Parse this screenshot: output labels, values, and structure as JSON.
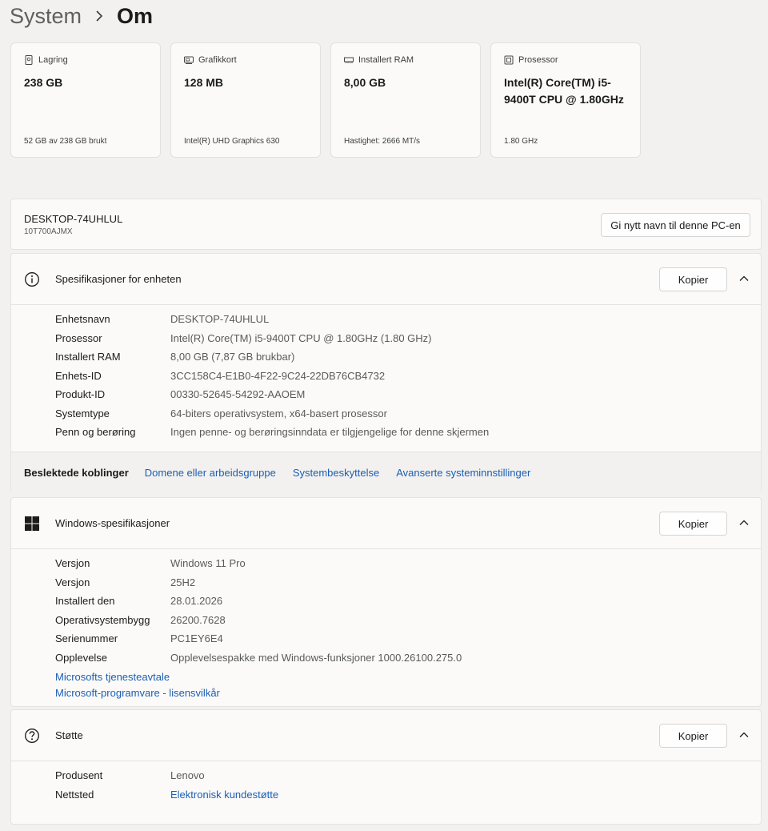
{
  "breadcrumb": {
    "parent": "System",
    "current": "Om"
  },
  "cards": [
    {
      "icon": "storage-icon",
      "label": "Lagring",
      "value": "238 GB",
      "sub": "52 GB av 238 GB brukt"
    },
    {
      "icon": "graphics-card-icon",
      "label": "Grafikkort",
      "value": "128 MB",
      "sub": "Intel(R) UHD Graphics 630"
    },
    {
      "icon": "ram-icon",
      "label": "Installert RAM",
      "value": "8,00 GB",
      "sub": "Hastighet: 2666 MT/s"
    },
    {
      "icon": "processor-icon",
      "label": "Prosessor",
      "value": "Intel(R) Core(TM) i5-9400T CPU @ 1.80GHz",
      "sub": "1.80 GHz"
    }
  ],
  "device": {
    "name": "DESKTOP-74UHLUL",
    "model": "10T700AJMX",
    "rename_label": "Gi nytt navn til denne PC-en"
  },
  "device_specs": {
    "title": "Spesifikasjoner for enheten",
    "copy_label": "Kopier",
    "rows": [
      {
        "key": "Enhetsnavn",
        "value": "DESKTOP-74UHLUL"
      },
      {
        "key": "Prosessor",
        "value": "Intel(R) Core(TM) i5-9400T CPU @ 1.80GHz (1.80 GHz)"
      },
      {
        "key": "Installert RAM",
        "value": "8,00 GB (7,87 GB brukbar)"
      },
      {
        "key": "Enhets-ID",
        "value": "3CC158C4-E1B0-4F22-9C24-22DB76CB4732"
      },
      {
        "key": "Produkt-ID",
        "value": "00330-52645-54292-AAOEM"
      },
      {
        "key": "Systemtype",
        "value": "64-biters operativsystem, x64-basert prosessor"
      },
      {
        "key": "Penn og berøring",
        "value": "Ingen penne- og berøringsinndata er tilgjengelige for denne skjermen"
      }
    ],
    "related_label": "Beslektede koblinger",
    "related_links": [
      "Domene eller arbeidsgruppe",
      "Systembeskyttelse",
      "Avanserte systeminnstillinger"
    ]
  },
  "windows_specs": {
    "title": "Windows-spesifikasjoner",
    "copy_label": "Kopier",
    "rows": [
      {
        "key": "Versjon",
        "value": "Windows 11 Pro"
      },
      {
        "key": "Versjon",
        "value": "25H2"
      },
      {
        "key": "Installert den",
        "value": "28.01.2026"
      },
      {
        "key": "Operativsystembygg",
        "value": "26200.7628"
      },
      {
        "key": "Serienummer",
        "value": "PC1EY6E4"
      },
      {
        "key": "Opplevelse",
        "value": "Opplevelsespakke med Windows-funksjoner 1000.26100.275.0"
      }
    ],
    "links": [
      "Microsofts tjenesteavtale",
      "Microsoft-programvare - lisensvilkår"
    ]
  },
  "support": {
    "title": "Støtte",
    "copy_label": "Kopier",
    "rows": [
      {
        "key": "Produsent",
        "value": "Lenovo"
      },
      {
        "key": "Nettsted",
        "value": "Elektronisk kundestøtte"
      }
    ]
  },
  "colors": {
    "link": "#1a5fb4",
    "background": "#f3f1ef",
    "card": "#fbfaf9"
  }
}
